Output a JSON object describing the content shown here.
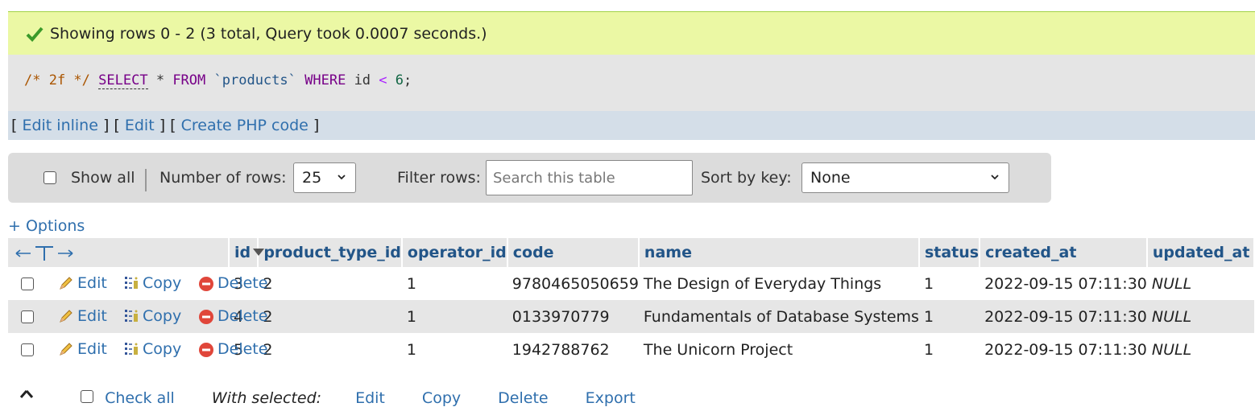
{
  "message": "Showing rows 0 - 2 (3 total, Query took 0.0007 seconds.)",
  "sql": {
    "comment": "/* 2f */",
    "select": "SELECT",
    "star": "*",
    "from": "FROM",
    "table": "`products`",
    "where": "WHERE",
    "col": "id",
    "op": "<",
    "num": "6",
    "end": ";"
  },
  "links": {
    "edit_inline": "Edit inline",
    "edit": "Edit",
    "create_php": "Create PHP code"
  },
  "navbar": {
    "show_all": "Show all",
    "num_rows_label": "Number of rows:",
    "num_rows_value": "25",
    "filter_label": "Filter rows:",
    "filter_placeholder": "Search this table",
    "sort_label": "Sort by key:",
    "sort_value": "None"
  },
  "options": "+ Options",
  "columns": [
    "id",
    "product_type_id",
    "operator_id",
    "code",
    "name",
    "status",
    "created_at",
    "updated_at"
  ],
  "actions": {
    "edit": "Edit",
    "copy": "Copy",
    "delete": "Delete"
  },
  "rows": [
    [
      "3",
      "2",
      "1",
      "9780465050659",
      "The Design of Everyday Things",
      "1",
      "2022-09-15 07:11:30",
      "NULL"
    ],
    [
      "4",
      "2",
      "1",
      "0133970779",
      "Fundamentals of Database Systems",
      "1",
      "2022-09-15 07:11:30",
      "NULL"
    ],
    [
      "5",
      "2",
      "1",
      "1942788762",
      "The Unicorn Project",
      "1",
      "2022-09-15 07:11:30",
      "NULL"
    ]
  ],
  "bottom": {
    "check_all": "Check all",
    "with_selected": "With selected:",
    "edit": "Edit",
    "copy": "Copy",
    "delete": "Delete",
    "export": "Export"
  },
  "colors": {
    "success_bg": "#ebf8a4",
    "link": "#2f6fad",
    "header_text": "#225588"
  }
}
